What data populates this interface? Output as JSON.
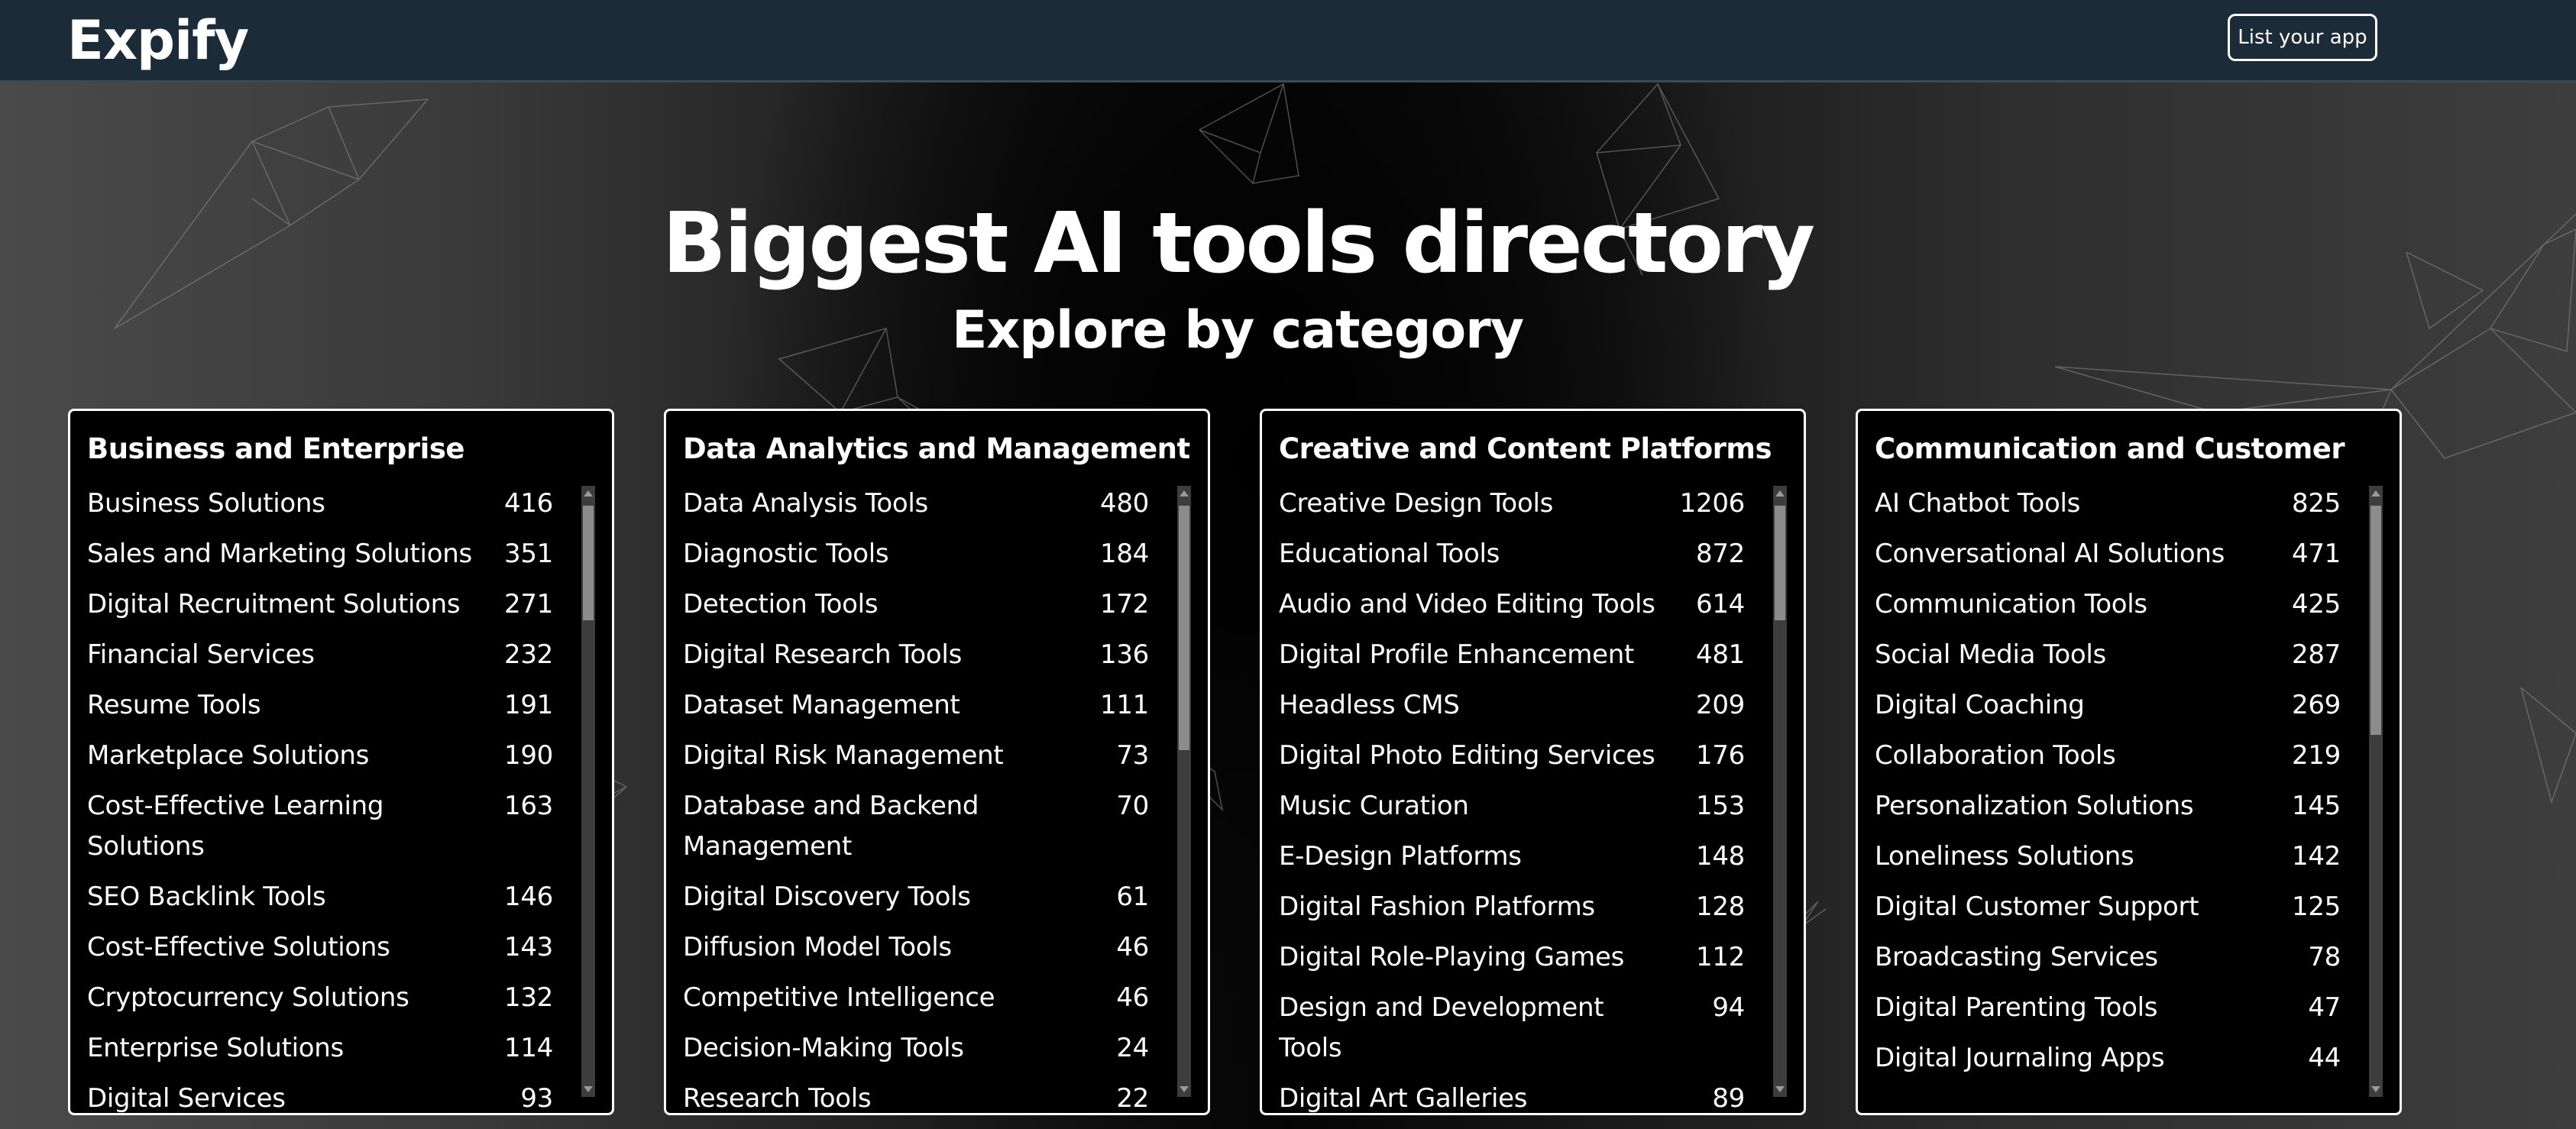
{
  "header": {
    "logo": "Expify",
    "list_app_label": "List your app"
  },
  "hero": {
    "title": "Biggest AI tools directory",
    "subtitle": "Explore by category"
  },
  "categories": [
    {
      "title": "Business and Enterprise",
      "scroll_position": 0,
      "items": [
        {
          "name": "Business Solutions",
          "count": "416"
        },
        {
          "name": "Sales and Marketing Solutions",
          "count": "351"
        },
        {
          "name": "Digital Recruitment Solutions",
          "count": "271"
        },
        {
          "name": "Financial Services",
          "count": "232"
        },
        {
          "name": "Resume Tools",
          "count": "191"
        },
        {
          "name": "Marketplace Solutions",
          "count": "190"
        },
        {
          "name": "Cost-Effective Learning Solutions",
          "count": "163"
        },
        {
          "name": "SEO Backlink Tools",
          "count": "146"
        },
        {
          "name": "Cost-Effective Solutions",
          "count": "143"
        },
        {
          "name": "Cryptocurrency Solutions",
          "count": "132"
        },
        {
          "name": "Enterprise Solutions",
          "count": "114"
        },
        {
          "name": "Digital Services",
          "count": "93"
        }
      ]
    },
    {
      "title": "Data Analytics and Management",
      "scroll_position": 0,
      "items": [
        {
          "name": "Data Analysis Tools",
          "count": "480"
        },
        {
          "name": "Diagnostic Tools",
          "count": "184"
        },
        {
          "name": "Detection Tools",
          "count": "172"
        },
        {
          "name": "Digital Research Tools",
          "count": "136"
        },
        {
          "name": "Dataset Management",
          "count": "111"
        },
        {
          "name": "Digital Risk Management",
          "count": "73"
        },
        {
          "name": "Database and Backend Management",
          "count": "70"
        },
        {
          "name": "Digital Discovery Tools",
          "count": "61"
        },
        {
          "name": "Diffusion Model Tools",
          "count": "46"
        },
        {
          "name": "Competitive Intelligence",
          "count": "46"
        },
        {
          "name": "Decision-Making Tools",
          "count": "24"
        },
        {
          "name": "Research Tools",
          "count": "22"
        }
      ]
    },
    {
      "title": "Creative and Content Platforms",
      "scroll_position": 0,
      "items": [
        {
          "name": "Creative Design Tools",
          "count": "1206"
        },
        {
          "name": "Educational Tools",
          "count": "872"
        },
        {
          "name": "Audio and Video Editing Tools",
          "count": "614"
        },
        {
          "name": "Digital Profile Enhancement",
          "count": "481"
        },
        {
          "name": "Headless CMS",
          "count": "209"
        },
        {
          "name": "Digital Photo Editing Services",
          "count": "176"
        },
        {
          "name": "Music Curation",
          "count": "153"
        },
        {
          "name": "E-Design Platforms",
          "count": "148"
        },
        {
          "name": "Digital Fashion Platforms",
          "count": "128"
        },
        {
          "name": "Digital Role-Playing Games",
          "count": "112"
        },
        {
          "name": "Design and Development Tools",
          "count": "94"
        },
        {
          "name": "Digital Art Galleries",
          "count": "89"
        }
      ]
    },
    {
      "title": "Communication and Customer",
      "scroll_position": 0,
      "items": [
        {
          "name": "AI Chatbot Tools",
          "count": "825"
        },
        {
          "name": "Conversational AI Solutions",
          "count": "471"
        },
        {
          "name": "Communication Tools",
          "count": "425"
        },
        {
          "name": "Social Media Tools",
          "count": "287"
        },
        {
          "name": "Digital Coaching",
          "count": "269"
        },
        {
          "name": "Collaboration Tools",
          "count": "219"
        },
        {
          "name": "Personalization Solutions",
          "count": "145"
        },
        {
          "name": "Loneliness Solutions",
          "count": "142"
        },
        {
          "name": "Digital Customer Support",
          "count": "125"
        },
        {
          "name": "Broadcasting Services",
          "count": "78"
        },
        {
          "name": "Digital Parenting Tools",
          "count": "47"
        },
        {
          "name": "Digital Journaling Apps",
          "count": "44"
        }
      ]
    }
  ]
}
